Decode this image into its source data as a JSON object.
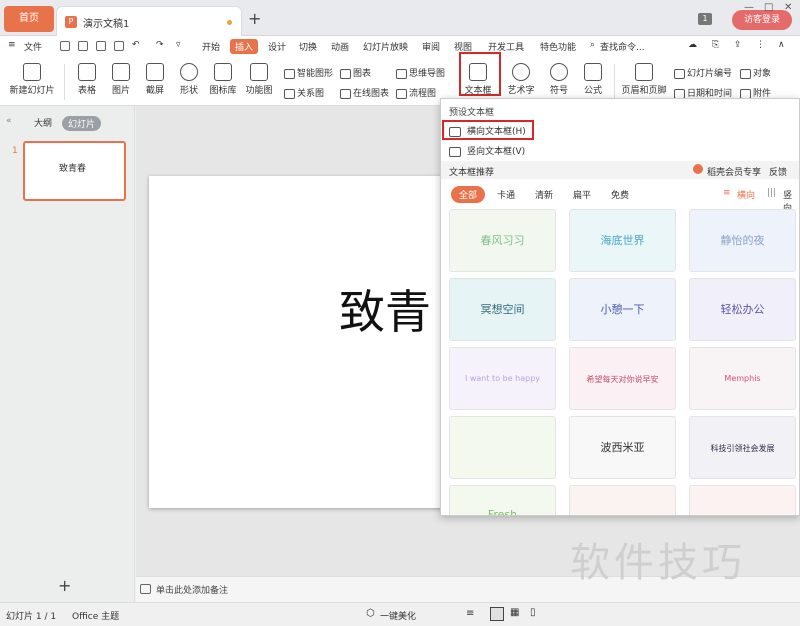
{
  "tabs": {
    "home": "首页",
    "doc": "演示文稿1",
    "badge": "1",
    "login": "访客登录"
  },
  "menubar": {
    "file": "文件",
    "items": [
      "开始",
      "插入",
      "设计",
      "切换",
      "动画",
      "幻灯片放映",
      "审阅",
      "视图",
      "开发工具",
      "特色功能"
    ],
    "search": "查找命令..."
  },
  "ribbon": {
    "new_slide": "新建幻灯片",
    "table": "表格",
    "picture": "图片",
    "screenshot": "截屏",
    "shape": "形状",
    "icon_lib": "图标库",
    "func_chart": "功能图",
    "smart_shape": "智能图形",
    "chart": "图表",
    "mind_map": "思维导图",
    "relation": "关系图",
    "online_chart": "在线图表",
    "flowchart": "流程图",
    "textbox": "文本框",
    "art_text": "艺术字",
    "symbol": "符号",
    "formula": "公式",
    "header_footer": "页眉和页脚",
    "slide_num": "幻灯片编号",
    "object": "对象",
    "datetime": "日期和时间",
    "attachment": "附件"
  },
  "leftpanel": {
    "outline": "大纲",
    "slides": "幻灯片",
    "slide_number": "1",
    "thumb_text": "致青春"
  },
  "slide": {
    "title": "致青"
  },
  "notes": {
    "placeholder": "单击此处添加备注"
  },
  "status": {
    "slide_count": "幻灯片 1 / 1",
    "theme": "Office 主题",
    "beautify": "一键美化"
  },
  "dropdown": {
    "preset_header": "预设文本框",
    "horizontal": "横向文本框(H)",
    "vertical": "竖向文本框(V)",
    "recommend_header": "文本框推荐",
    "vip": "稻壳会员专享",
    "feedback": "反馈",
    "categories": [
      "全部",
      "卡通",
      "清新",
      "扁平",
      "免费"
    ],
    "orient_h": "横向",
    "orient_v": "竖向",
    "cards": [
      {
        "label": "春风习习",
        "color": "#7fbf8a"
      },
      {
        "label": "海底世界",
        "color": "#4aa7c8"
      },
      {
        "label": "静怡的夜",
        "color": "#8aa3c8"
      },
      {
        "label": "冥想空间",
        "color": "#2f6a7a"
      },
      {
        "label": "小憩一下",
        "color": "#4b5fa8"
      },
      {
        "label": "轻松办公",
        "color": "#5a56a8"
      },
      {
        "label": "I want to be happy",
        "color": "#b8a6d8"
      },
      {
        "label": "希望每天对你说早安",
        "color": "#c0506a"
      },
      {
        "label": "Memphis",
        "color": "#d0507a"
      },
      {
        "label": "",
        "color": "#7cbf6a"
      },
      {
        "label": "波西米亚",
        "color": "#333333"
      },
      {
        "label": "科技引领社会发展",
        "color": "#2a2a4a"
      },
      {
        "label": "Fresh",
        "color": "#7cbf6a"
      },
      {
        "label": "",
        "color": "#a03030"
      },
      {
        "label": "",
        "color": "#c02020"
      }
    ]
  },
  "watermark": "软件技巧"
}
